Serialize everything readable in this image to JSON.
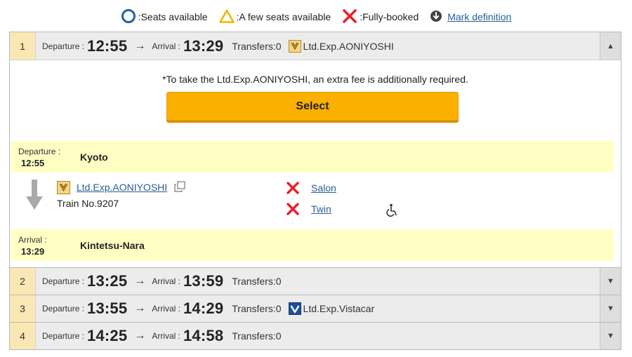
{
  "legend": {
    "available": ":Seats available",
    "few": ":A few seats available",
    "full": ":Fully-booked",
    "mark_definition": "Mark definition"
  },
  "colors": {
    "accent": "#fbb000",
    "link": "#2b5d97",
    "station_bg": "#ffffc4",
    "fully_booked": "#e8202a"
  },
  "results": [
    {
      "num": "1",
      "dep_label": "Departure :",
      "dep_time": "12:55",
      "arr_label": "Arrival :",
      "arr_time": "13:29",
      "transfers": "Transfers:0",
      "train": "Ltd.Exp.AONIYOSHI",
      "train_icon": "aoniyoshi-icon",
      "expanded": true
    },
    {
      "num": "2",
      "dep_label": "Departure :",
      "dep_time": "13:25",
      "arr_label": "Arrival :",
      "arr_time": "13:59",
      "transfers": "Transfers:0",
      "train": "",
      "expanded": false
    },
    {
      "num": "3",
      "dep_label": "Departure :",
      "dep_time": "13:55",
      "arr_label": "Arrival :",
      "arr_time": "14:29",
      "transfers": "Transfers:0",
      "train": "Ltd.Exp.Vistacar",
      "train_icon": "vistacar-icon",
      "expanded": false
    },
    {
      "num": "4",
      "dep_label": "Departure :",
      "dep_time": "14:25",
      "arr_label": "Arrival :",
      "arr_time": "14:58",
      "transfers": "Transfers:0",
      "train": "",
      "expanded": false
    }
  ],
  "detail": {
    "note": "*To take the Ltd.Exp.AONIYOSHI, an extra fee is additionally required.",
    "select_label": "Select",
    "departure": {
      "label": "Departure :",
      "time": "12:55",
      "station": "Kyoto"
    },
    "segment": {
      "train_link": "Ltd.Exp.AONIYOSHI",
      "train_no": "Train No.9207"
    },
    "seats": [
      {
        "status": "fully-booked",
        "label": "Salon"
      },
      {
        "status": "fully-booked",
        "label": "Twin"
      }
    ],
    "arrival": {
      "label": "Arrival :",
      "time": "13:29",
      "station": "Kintetsu-Nara"
    }
  }
}
